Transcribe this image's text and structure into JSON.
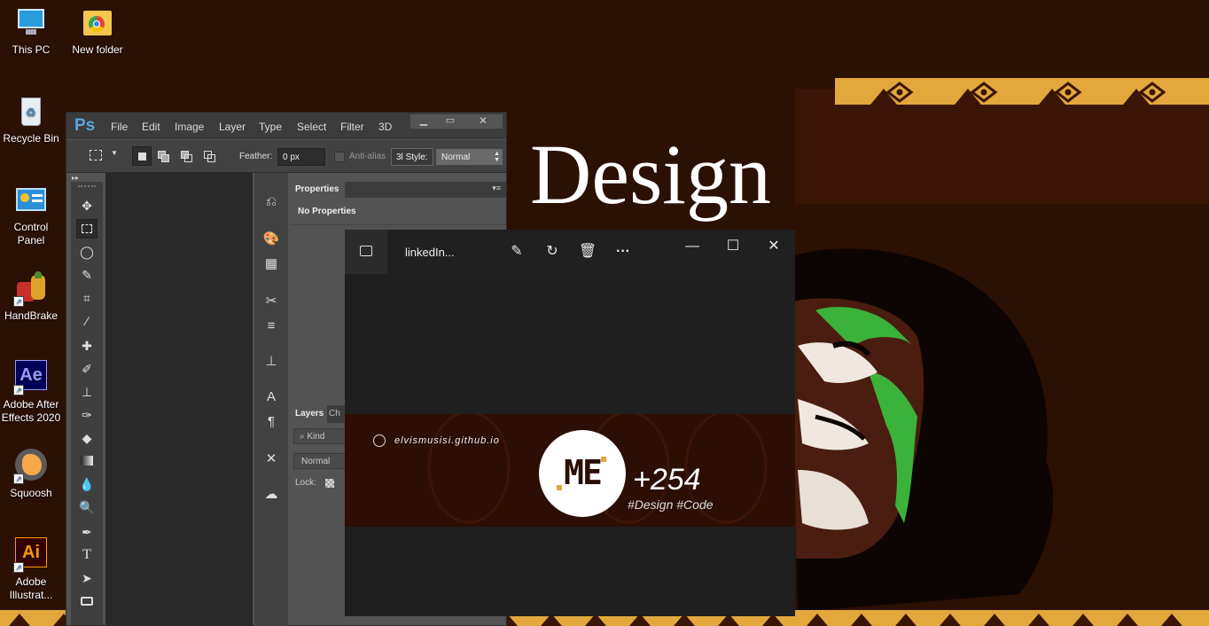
{
  "desktop": {
    "icons": [
      {
        "label": "This PC",
        "icon": "this-pc-icon"
      },
      {
        "label": "New folder",
        "icon": "folder-icon"
      },
      {
        "label": "Recycle Bin",
        "icon": "recycle-bin-icon"
      },
      {
        "label": "Control Panel",
        "icon": "control-panel-icon"
      },
      {
        "label": "HandBrake",
        "icon": "handbrake-icon"
      },
      {
        "label": "Adobe After Effects 2020",
        "icon": "after-effects-icon"
      },
      {
        "label": "Squoosh",
        "icon": "squoosh-icon"
      },
      {
        "label": "Adobe Illustrat...",
        "icon": "illustrator-icon"
      }
    ],
    "wallpaper_text": "Design",
    "colors": {
      "background": "#2b1004",
      "gold": "#e2a83c",
      "green": "#3bb33a"
    }
  },
  "photoshop": {
    "logo": "Ps",
    "menu": [
      "File",
      "Edit",
      "Image",
      "Layer",
      "Type",
      "Select",
      "Filter",
      "3D"
    ],
    "options": {
      "feather_label": "Feather:",
      "feather_value": "0 px",
      "antialias_label": "Anti-alias",
      "style_prefix": "3l",
      "style_label": "Style:",
      "style_value": "Normal"
    },
    "properties": {
      "tab": "Properties",
      "content": "No Properties"
    },
    "layers": {
      "tab": "Layers",
      "tab2": "Ch",
      "kind_placeholder": "Kind",
      "blend_mode": "Normal",
      "lock_label": "Lock:"
    }
  },
  "photos": {
    "title": "linkedIn...",
    "banner": {
      "website": "elvismusisi.github.io",
      "logo_text": "ME",
      "phone_code": "+254",
      "tags": "#Design #Code"
    }
  }
}
